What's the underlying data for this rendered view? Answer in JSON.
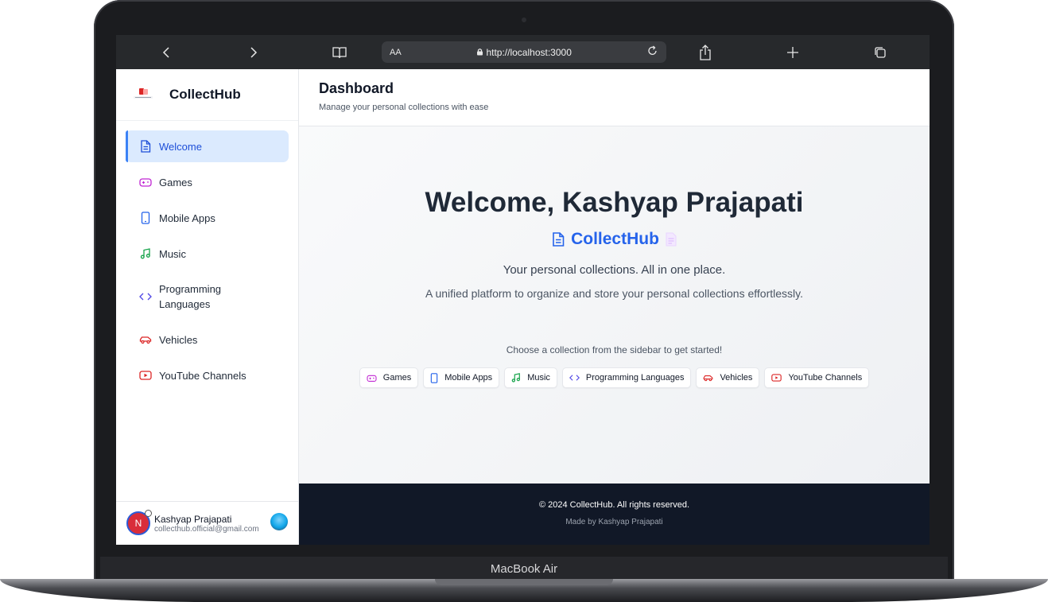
{
  "device": {
    "label": "MacBook Air"
  },
  "browser": {
    "text_size_label": "AA",
    "url": "http://localhost:3000",
    "icons": [
      "back-icon",
      "forward-icon",
      "book-icon",
      "lock-icon",
      "reload-icon",
      "share-icon",
      "new-tab-icon",
      "tabs-icon"
    ]
  },
  "sidebar": {
    "brand": "CollectHub",
    "items": [
      {
        "label": "Welcome",
        "icon": "document-icon",
        "color": "#1d4ed8",
        "active": true
      },
      {
        "label": "Games",
        "icon": "gamepad-icon",
        "color": "#c026d3"
      },
      {
        "label": "Mobile Apps",
        "icon": "phone-icon",
        "color": "#2563eb"
      },
      {
        "label": "Music",
        "icon": "music-icon",
        "color": "#16a34a"
      },
      {
        "label": "Programming Languages",
        "icon": "code-icon",
        "color": "#4f46e5"
      },
      {
        "label": "Vehicles",
        "icon": "car-icon",
        "color": "#dc2626"
      },
      {
        "label": "YouTube Channels",
        "icon": "youtube-icon",
        "color": "#dc2626"
      }
    ],
    "profile": {
      "initial": "N",
      "name": "Kashyap Prajapati",
      "email": "collecthub.official@gmail.com"
    }
  },
  "header": {
    "title": "Dashboard",
    "subtitle": "Manage your personal collections with ease"
  },
  "main": {
    "welcome": "Welcome, Kashyap Prajapati",
    "brand": "CollectHub",
    "tagline": "Your personal collections. All in one place.",
    "description": "A unified platform to organize and store your personal collections effortlessly.",
    "prompt": "Choose a collection from the sidebar to get started!",
    "chips": [
      "Games",
      "Mobile Apps",
      "Music",
      "Programming Languages",
      "Vehicles",
      "YouTube Channels"
    ]
  },
  "footer": {
    "copyright": "© 2024 CollectHub. All rights reserved.",
    "made_by": "Made by Kashyap Prajapati"
  }
}
